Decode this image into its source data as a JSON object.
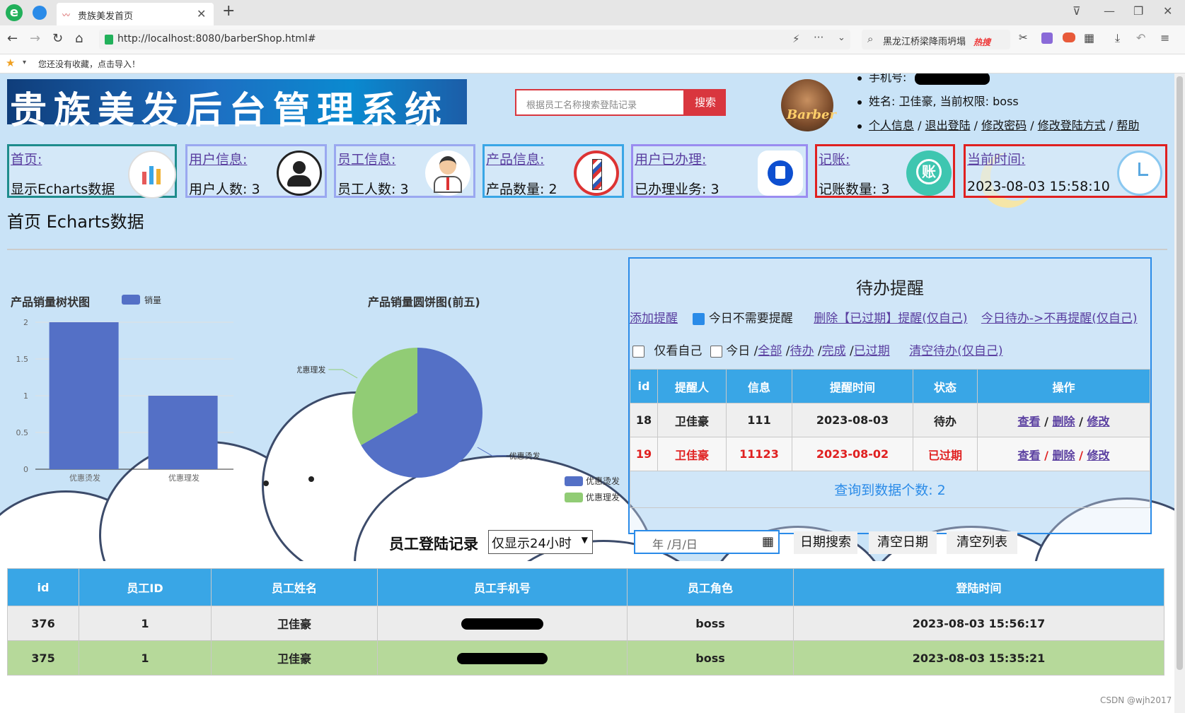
{
  "browser": {
    "tab_title": "贵族美发首页",
    "url": "http://localhost:8080/barberShop.html#",
    "search_text": "黑龙江桥梁降雨坍塌",
    "search_hot": "热搜",
    "bookmark_hint": "您还没有收藏，点击导入！"
  },
  "header": {
    "title": "贵族美发后台管理系统",
    "search_placeholder": "根据员工名称搜索登陆记录",
    "search_button": "搜索",
    "avatar_text": "Barber",
    "phone_label": "手机号:",
    "name_line": "姓名: 卫佳豪, 当前权限: boss",
    "links": [
      "个人信息",
      "退出登陆",
      "修改密码",
      "修改登陆方式",
      "帮助"
    ]
  },
  "cards": [
    {
      "link": "首页:",
      "value": "显示Echarts数据",
      "border": "#1e8c8c"
    },
    {
      "link": "用户信息:",
      "value": "用户人数: 3",
      "border": "#9aa8f0"
    },
    {
      "link": "员工信息:",
      "value": "员工人数: 3",
      "border": "#9aa8f0"
    },
    {
      "link": "产品信息:",
      "value": "产品数量: 2",
      "border": "#39a6e6"
    },
    {
      "link": "用户已办理:",
      "value": "已办理业务: 3",
      "border": "#9a8cf0"
    },
    {
      "link": "记账:",
      "value": "记账数量: 3",
      "border": "#e02020"
    },
    {
      "link": "当前时间:",
      "value": "2023-08-03 15:58:10",
      "border": "#e02020"
    }
  ],
  "section_title": "首页 Echarts数据",
  "chart_data": [
    {
      "type": "bar",
      "title": "产品销量树状图",
      "legend": [
        "销量"
      ],
      "categories": [
        "优惠烫发",
        "优惠理发"
      ],
      "series": [
        {
          "name": "销量",
          "values": [
            2,
            1
          ],
          "color": "#5470c6"
        }
      ],
      "ylim": [
        0,
        2
      ],
      "yticks": [
        "0",
        "0.5",
        "1",
        "1.5",
        "2"
      ]
    },
    {
      "type": "pie",
      "title": "产品销量圆饼图(前五)",
      "slices": [
        {
          "name": "优惠烫发",
          "value": 2,
          "color": "#5470c6"
        },
        {
          "name": "优惠理发",
          "value": 1,
          "color": "#91cc75"
        }
      ],
      "legend": [
        "优惠烫发",
        "优惠理发"
      ]
    }
  ],
  "todo": {
    "title": "待办提醒",
    "add_link": "添加提醒",
    "no_remind_today": "今日不需要提醒",
    "delete_expired": "删除【已过期】提醒(仅自己)",
    "today_todo": "今日待办->不再提醒(仅自己)",
    "only_me": "仅看自己",
    "today": "今日 /",
    "filters": [
      "全部",
      "待办",
      "完成",
      "已过期"
    ],
    "clear_todo": "清空待办(仅自己)",
    "columns": [
      "id",
      "提醒人",
      "信息",
      "提醒时间",
      "状态",
      "操作"
    ],
    "rows": [
      {
        "id": "18",
        "person": "卫佳豪",
        "info": "111",
        "time": "2023-08-03",
        "status": "待办",
        "expired": false
      },
      {
        "id": "19",
        "person": "卫佳豪",
        "info": "11123",
        "time": "2023-08-02",
        "status": "已过期",
        "expired": true
      }
    ],
    "ops": [
      "查看",
      "删除",
      "修改"
    ],
    "count_text": "查询到数据个数: 2"
  },
  "login": {
    "label": "员工登陆记录",
    "select_value": "仅显示24小时",
    "date_placeholder": "年 /月/日",
    "buttons": [
      "日期搜索",
      "清空日期",
      "清空列表"
    ],
    "columns": [
      "id",
      "员工ID",
      "员工姓名",
      "员工手机号",
      "员工角色",
      "登陆时间"
    ],
    "rows": [
      {
        "id": "376",
        "uid": "1",
        "name": "卫佳豪",
        "role": "boss",
        "time": "2023-08-03 15:56:17"
      },
      {
        "id": "375",
        "uid": "1",
        "name": "卫佳豪",
        "role": "boss",
        "time": "2023-08-03 15:35:21"
      }
    ]
  },
  "watermark": "CSDN @wjh2017"
}
